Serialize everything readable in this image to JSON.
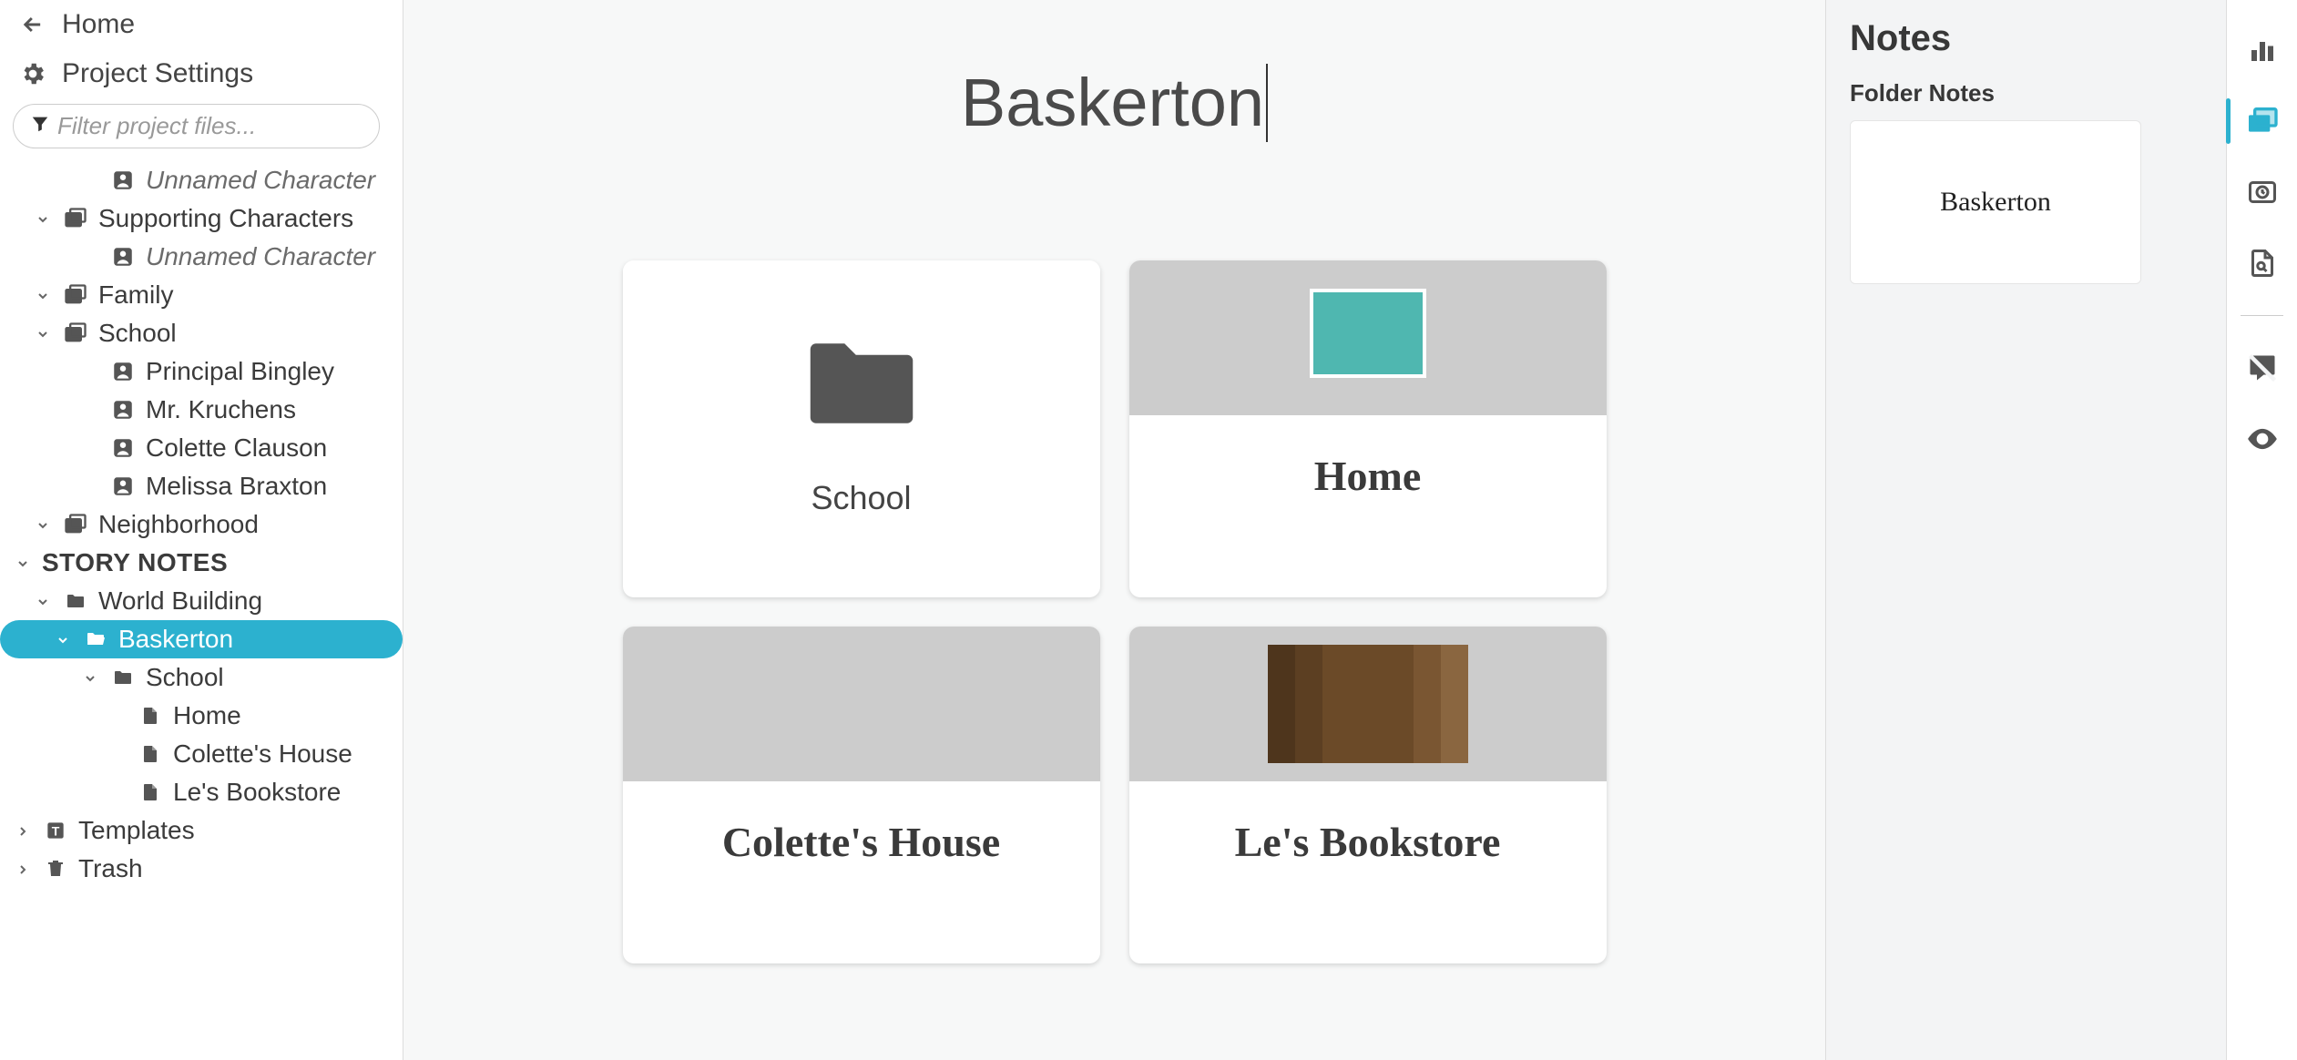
{
  "nav": {
    "home": "Home",
    "project_settings": "Project Settings"
  },
  "filter": {
    "placeholder": "Filter project files..."
  },
  "tree": [
    {
      "depth": 3,
      "icon": "person",
      "label": "Unnamed Character",
      "italic": true
    },
    {
      "depth": 1,
      "icon": "cards",
      "label": "Supporting Characters",
      "caret": "down"
    },
    {
      "depth": 3,
      "icon": "person",
      "label": "Unnamed Character",
      "italic": true
    },
    {
      "depth": 1,
      "icon": "cards",
      "label": "Family",
      "caret": "down"
    },
    {
      "depth": 1,
      "icon": "cards",
      "label": "School",
      "caret": "down"
    },
    {
      "depth": 3,
      "icon": "person",
      "label": "Principal Bingley"
    },
    {
      "depth": 3,
      "icon": "person",
      "label": "Mr. Kruchens"
    },
    {
      "depth": 3,
      "icon": "person",
      "label": "Colette Clauson"
    },
    {
      "depth": 3,
      "icon": "person",
      "label": "Melissa Braxton"
    },
    {
      "depth": 1,
      "icon": "cards",
      "label": "Neighborhood",
      "caret": "down"
    },
    {
      "depth": 0,
      "icon": "none",
      "label": "STORY NOTES",
      "caret": "down",
      "bold": true
    },
    {
      "depth": 1,
      "icon": "folder",
      "label": "World Building",
      "caret": "down"
    },
    {
      "depth": 2,
      "icon": "folder-open",
      "label": "Baskerton",
      "caret": "down",
      "selected": true
    },
    {
      "depth": 3,
      "icon": "folder",
      "label": "School",
      "caret": "down"
    },
    {
      "depth": 4,
      "icon": "doc",
      "label": "Home"
    },
    {
      "depth": 4,
      "icon": "doc",
      "label": "Colette's House"
    },
    {
      "depth": 4,
      "icon": "doc",
      "label": "Le's Bookstore"
    },
    {
      "depth": 0,
      "icon": "template",
      "label": "Templates",
      "caret": "right"
    },
    {
      "depth": 0,
      "icon": "trash",
      "label": "Trash",
      "caret": "right"
    }
  ],
  "page": {
    "title": "Baskerton",
    "cards": [
      {
        "title": "School",
        "type": "folder"
      },
      {
        "title": "Home",
        "type": "image",
        "imgclass": "ph-home"
      },
      {
        "title": "Colette's House",
        "type": "image",
        "imgclass": "ph-house"
      },
      {
        "title": "Le's Bookstore",
        "type": "image",
        "imgclass": "ph-book"
      }
    ]
  },
  "notes": {
    "heading": "Notes",
    "subheading": "Folder Notes",
    "card_title": "Baskerton"
  },
  "rail_icons": [
    "stats",
    "notes",
    "history",
    "find",
    "comments",
    "visibility"
  ]
}
